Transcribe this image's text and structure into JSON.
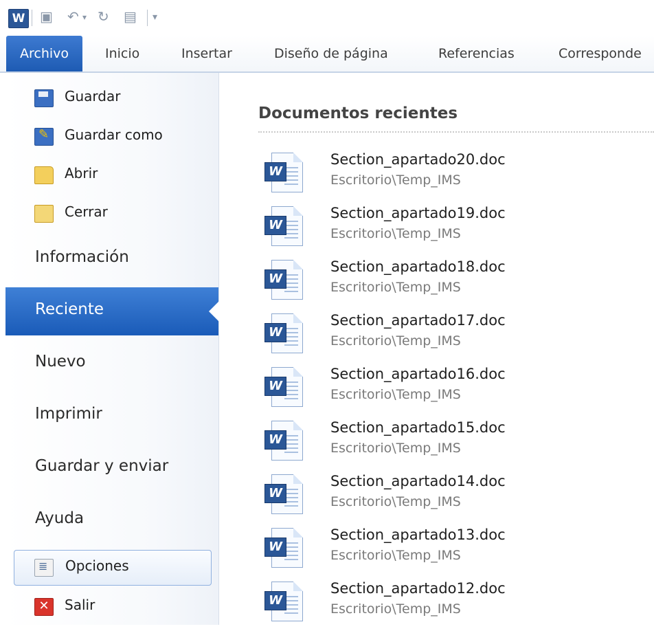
{
  "quick_access": {
    "app_letter": "W",
    "icons": [
      "word-icon",
      "save-icon",
      "undo-icon",
      "redo-icon",
      "print-preview-icon",
      "customize-icon"
    ]
  },
  "tabs": [
    "Archivo",
    "Inicio",
    "Insertar",
    "Diseño de página",
    "Referencias",
    "Corresponde"
  ],
  "nav": {
    "commands": [
      {
        "label": "Guardar",
        "icon": "save-icon"
      },
      {
        "label": "Guardar como",
        "icon": "save-as-icon"
      },
      {
        "label": "Abrir",
        "icon": "open-folder-icon"
      },
      {
        "label": "Cerrar",
        "icon": "close-folder-icon"
      }
    ],
    "tabs": [
      "Información",
      "Reciente",
      "Nuevo",
      "Imprimir",
      "Guardar y enviar",
      "Ayuda"
    ],
    "active_tab": "Reciente",
    "options_label": "Opciones",
    "exit_label": "Salir"
  },
  "recent": {
    "title": "Documentos recientes",
    "documents": [
      {
        "name": "Section_apartado20.doc",
        "path": "Escritorio\\Temp_IMS"
      },
      {
        "name": "Section_apartado19.doc",
        "path": "Escritorio\\Temp_IMS"
      },
      {
        "name": "Section_apartado18.doc",
        "path": "Escritorio\\Temp_IMS"
      },
      {
        "name": "Section_apartado17.doc",
        "path": "Escritorio\\Temp_IMS"
      },
      {
        "name": "Section_apartado16.doc",
        "path": "Escritorio\\Temp_IMS"
      },
      {
        "name": "Section_apartado15.doc",
        "path": "Escritorio\\Temp_IMS"
      },
      {
        "name": "Section_apartado14.doc",
        "path": "Escritorio\\Temp_IMS"
      },
      {
        "name": "Section_apartado13.doc",
        "path": "Escritorio\\Temp_IMS"
      },
      {
        "name": "Section_apartado12.doc",
        "path": "Escritorio\\Temp_IMS"
      }
    ]
  },
  "colors": {
    "accent": "#1e5bb3",
    "exit": "#d9342b"
  }
}
